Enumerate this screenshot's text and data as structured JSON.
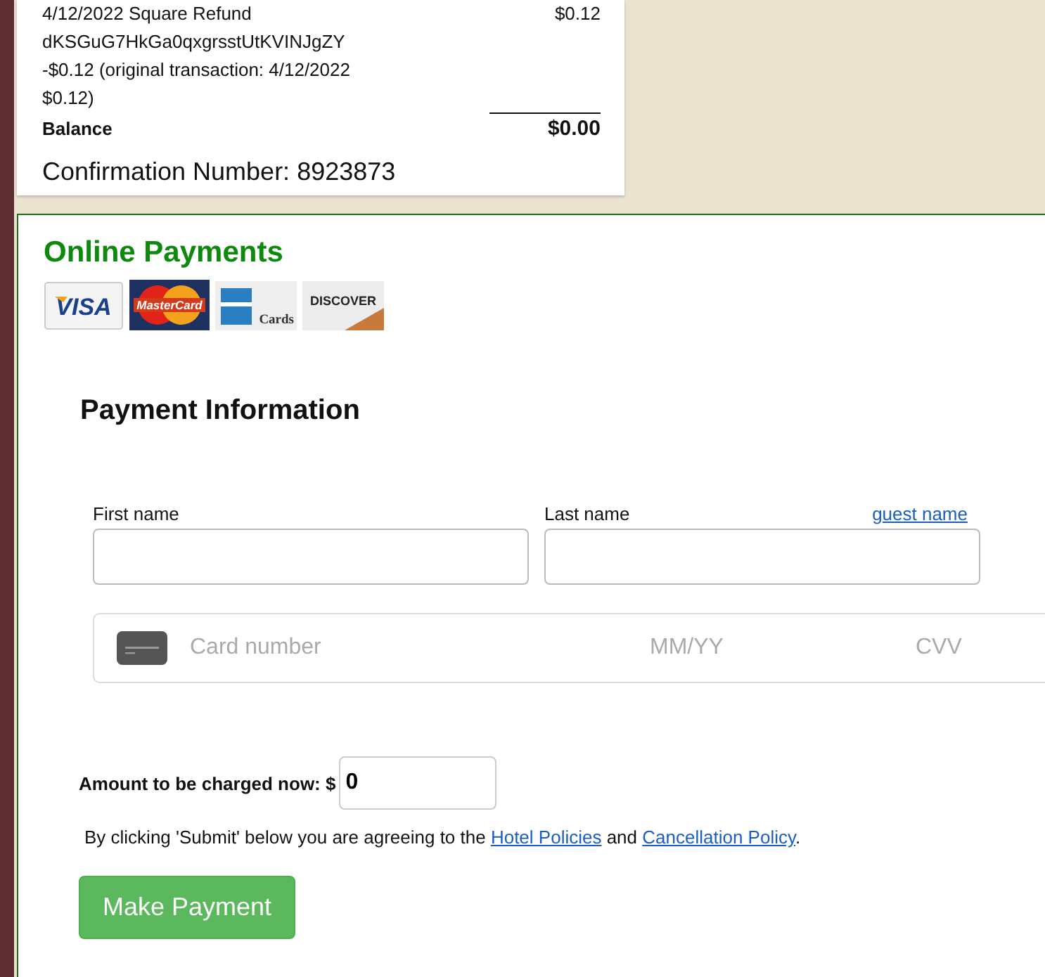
{
  "receipt": {
    "description_lines": [
      "4/12/2022 Square Refund",
      "dKSGuG7HkGa0qxgrsstUtKVINJgZY",
      "-$0.12 (original transaction: 4/12/2022",
      "$0.12)"
    ],
    "amount": "$0.12",
    "balance_label": "Balance",
    "balance_value": "$0.00",
    "confirmation": "Confirmation Number: 8923873"
  },
  "online_payments": {
    "title": "Online Payments",
    "card_logos": [
      {
        "kind": "visa",
        "text": "VISA"
      },
      {
        "kind": "mastercard",
        "text": "MasterCard"
      },
      {
        "kind": "amex",
        "text": "Cards"
      },
      {
        "kind": "discover",
        "text": "DISCOVER"
      }
    ],
    "heading": "Payment Information",
    "first_name": {
      "label": "First name"
    },
    "last_name": {
      "label": "Last name",
      "link": "guest name"
    },
    "card": {
      "number_placeholder": "Card number",
      "expiry_placeholder": "MM/YY",
      "cvv_placeholder": "CVV"
    },
    "amount": {
      "label": "Amount to be charged now: $",
      "value": "0"
    },
    "agreement": {
      "before": "By clicking 'Submit' below you are agreeing to the ",
      "link_1": "Hotel Policies",
      "middle": " and ",
      "link_2": "Cancellation Policy",
      "after": "."
    },
    "button": "Make Payment"
  }
}
